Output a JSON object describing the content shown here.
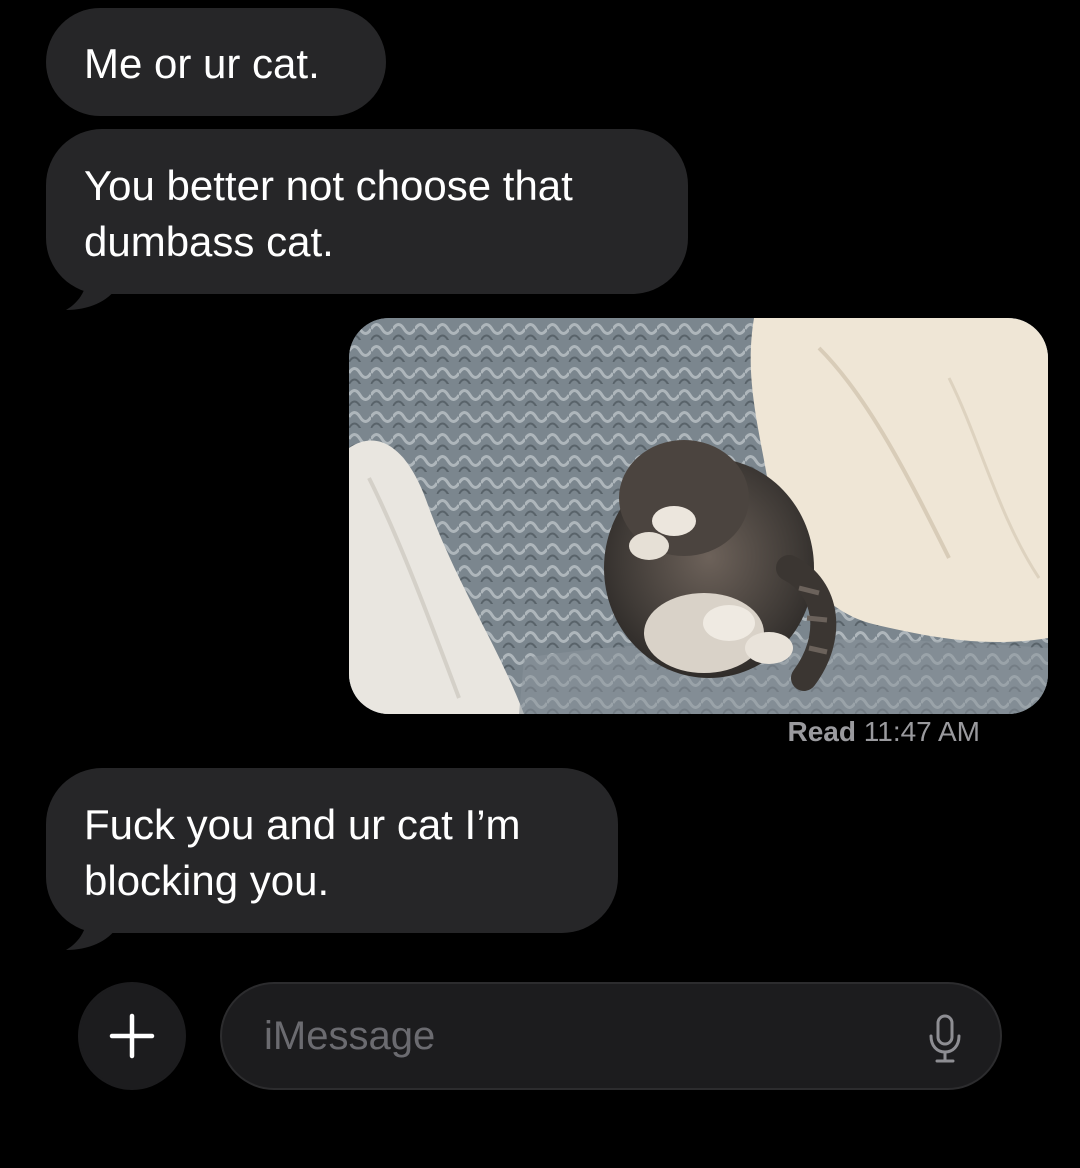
{
  "conversation": {
    "messages": [
      {
        "direction": "incoming",
        "text": "Me or ur cat."
      },
      {
        "direction": "incoming",
        "text": "You better not choose that\ndumbass cat."
      },
      {
        "direction": "outgoing",
        "type": "image",
        "image_description": "kitten"
      },
      {
        "direction": "incoming",
        "text": "Fuck you and ur cat I’m\nblocking you."
      }
    ],
    "read_receipt": {
      "label": "Read",
      "time": "11:47 AM"
    }
  },
  "composer": {
    "placeholder": "iMessage",
    "add_icon": "plus-icon",
    "mic_icon": "microphone-icon"
  },
  "colors": {
    "background": "#000000",
    "incoming_bubble": "#262628",
    "composer_bg": "#1c1c1e",
    "receipt_text": "#9a9a9e",
    "placeholder": "#6b6b70"
  }
}
